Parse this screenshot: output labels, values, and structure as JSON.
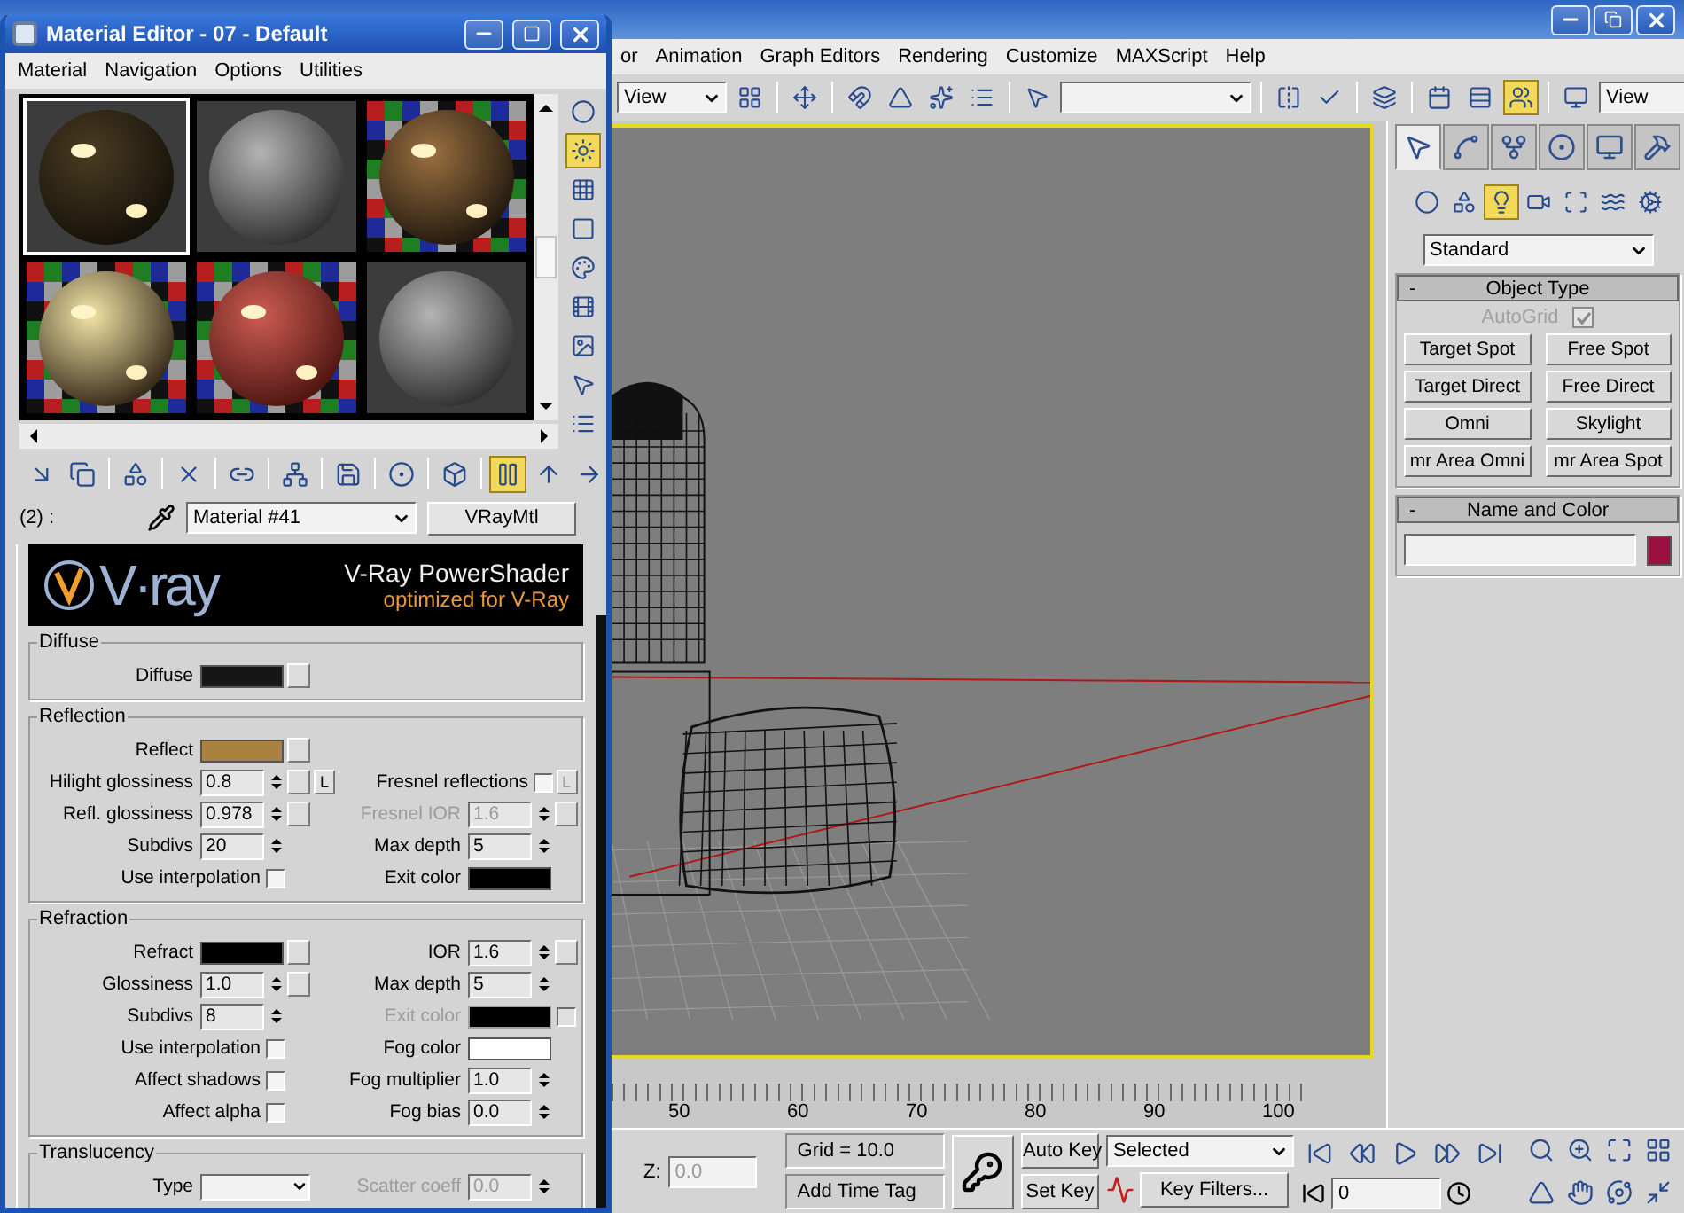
{
  "material_editor": {
    "title": "Material Editor - 07 - Default",
    "menu": [
      {
        "label": "Material"
      },
      {
        "label": "Navigation"
      },
      {
        "label": "Options"
      },
      {
        "label": "Utilities"
      }
    ],
    "samples": [
      {
        "kind": "dark",
        "checker": false,
        "selected": true
      },
      {
        "kind": "grey",
        "checker": false,
        "selected": false
      },
      {
        "kind": "bronze",
        "checker": true,
        "selected": false
      },
      {
        "kind": "mirror",
        "checker": true,
        "selected": false
      },
      {
        "kind": "red",
        "checker": true,
        "selected": false
      },
      {
        "kind": "grey",
        "checker": false,
        "selected": false
      }
    ],
    "side_tools": [
      {
        "kind": "circle",
        "on": false
      },
      {
        "kind": "sun",
        "on": true
      },
      {
        "kind": "grid",
        "on": false
      },
      {
        "kind": "square",
        "on": false
      },
      {
        "kind": "palette",
        "on": false
      },
      {
        "kind": "film",
        "on": false
      },
      {
        "kind": "image",
        "on": false
      },
      {
        "kind": "pointer",
        "on": false
      },
      {
        "kind": "list",
        "on": false
      }
    ],
    "toolbar": [
      {
        "kind": "arrow-down-right",
        "on": false
      },
      {
        "kind": "copy",
        "on": false
      },
      {
        "kind": "separator"
      },
      {
        "kind": "shapes",
        "on": false
      },
      {
        "kind": "separator"
      },
      {
        "kind": "cross",
        "on": false
      },
      {
        "kind": "separator"
      },
      {
        "kind": "link",
        "on": false
      },
      {
        "kind": "separator"
      },
      {
        "kind": "network",
        "on": false
      },
      {
        "kind": "separator"
      },
      {
        "kind": "save",
        "on": false
      },
      {
        "kind": "separator"
      },
      {
        "kind": "circle-dot",
        "on": false
      },
      {
        "kind": "separator"
      },
      {
        "kind": "box",
        "on": false
      },
      {
        "kind": "separator"
      },
      {
        "kind": "vertical-bars",
        "on": true
      },
      {
        "kind": "arrow-up",
        "on": false
      },
      {
        "kind": "arrow-right",
        "on": false
      }
    ],
    "slot_label": "(2) :",
    "material_name": "Material #41",
    "material_type": "VRayMtl",
    "banner": {
      "logo": "V·ray",
      "title": "V-Ray PowerShader",
      "subtitle": "optimized for V-Ray"
    },
    "groups": [
      {
        "title": "Diffuse",
        "rows": [
          {
            "left": {
              "kind": "color",
              "label": "Diffuse",
              "color": "#161616",
              "map": true
            }
          }
        ]
      },
      {
        "title": "Reflection",
        "rows": [
          {
            "left": {
              "kind": "color",
              "label": "Reflect",
              "color": "#a8823e",
              "map": true
            }
          },
          {
            "left": {
              "kind": "spinner",
              "label": "Hilight glossiness",
              "value": "0.8",
              "map": true,
              "lock": {
                "label": "L",
                "disabled": false
              }
            },
            "right": {
              "kind": "check",
              "label": "Fresnel reflections",
              "checked": false,
              "lock": {
                "label": "L",
                "disabled": true
              }
            }
          },
          {
            "left": {
              "kind": "spinner",
              "label": "Refl. glossiness",
              "value": "0.978",
              "map": true
            },
            "right": {
              "kind": "spinner",
              "label": "Fresnel IOR",
              "value": "1.6",
              "map": true,
              "disabled": true
            }
          },
          {
            "left": {
              "kind": "spinner",
              "label": "Subdivs",
              "value": "20"
            },
            "right": {
              "kind": "spinner",
              "label": "Max depth",
              "value": "5"
            }
          },
          {
            "left": {
              "kind": "check",
              "label": "Use interpolation",
              "checked": false
            },
            "right": {
              "kind": "color",
              "label": "Exit color",
              "color": "#000000"
            }
          }
        ]
      },
      {
        "title": "Refraction",
        "rows": [
          {
            "left": {
              "kind": "color",
              "label": "Refract",
              "color": "#000000",
              "map": true
            },
            "right": {
              "kind": "spinner",
              "label": "IOR",
              "value": "1.6",
              "map": true
            }
          },
          {
            "left": {
              "kind": "spinner",
              "label": "Glossiness",
              "value": "1.0",
              "map": true
            },
            "right": {
              "kind": "spinner",
              "label": "Max depth",
              "value": "5"
            }
          },
          {
            "left": {
              "kind": "spinner",
              "label": "Subdivs",
              "value": "8"
            },
            "right": {
              "kind": "color",
              "label": "Exit color",
              "color": "#000000",
              "disabled": true,
              "checked": false
            }
          },
          {
            "left": {
              "kind": "check",
              "label": "Use interpolation",
              "checked": false
            },
            "right": {
              "kind": "color",
              "label": "Fog color",
              "color": "#ffffff"
            }
          },
          {
            "left": {
              "kind": "check",
              "label": "Affect shadows",
              "checked": false
            },
            "right": {
              "kind": "spinner",
              "label": "Fog multiplier",
              "value": "1.0"
            }
          },
          {
            "left": {
              "kind": "check",
              "label": "Affect alpha",
              "checked": false
            },
            "right": {
              "kind": "spinner",
              "label": "Fog bias",
              "value": "0.0"
            }
          }
        ]
      },
      {
        "title": "Translucency",
        "rows": [
          {
            "left": {
              "kind": "dropdown",
              "label": "Type"
            },
            "right": {
              "kind": "spinner",
              "label": "Scatter coeff",
              "value": "0.0",
              "disabled": true
            }
          }
        ]
      }
    ]
  },
  "main": {
    "menu": [
      {
        "label": "or"
      },
      {
        "label": "Animation"
      },
      {
        "label": "Graph Editors"
      },
      {
        "label": "Rendering"
      },
      {
        "label": "Customize"
      },
      {
        "label": "MAXScript"
      },
      {
        "label": "Help"
      }
    ],
    "toolbar": [
      {
        "kind": "dropdown",
        "value": "View"
      },
      {
        "kind": "layout-grid",
        "on": false
      },
      {
        "kind": "separator"
      },
      {
        "kind": "move",
        "on": false
      },
      {
        "kind": "separator"
      },
      {
        "kind": "magnet",
        "on": false
      },
      {
        "kind": "triangle",
        "on": false
      },
      {
        "kind": "sparkles",
        "on": false
      },
      {
        "kind": "list",
        "on": false
      },
      {
        "kind": "separator"
      },
      {
        "kind": "pointer",
        "on": false
      },
      {
        "kind": "dropdown"
      },
      {
        "kind": "separator"
      },
      {
        "kind": "mirror",
        "on": false
      },
      {
        "kind": "check",
        "on": false
      },
      {
        "kind": "separator"
      },
      {
        "kind": "layers",
        "on": false
      },
      {
        "kind": "separator"
      },
      {
        "kind": "calendar",
        "on": false
      },
      {
        "kind": "rows",
        "on": false
      },
      {
        "kind": "users",
        "on": true
      },
      {
        "kind": "separator"
      },
      {
        "kind": "monitor",
        "on": false
      },
      {
        "kind": "dropdown",
        "value": "View"
      }
    ],
    "viewport": {
      "active": true
    },
    "ruler": {
      "labels": [
        "50",
        "60",
        "70",
        "80",
        "90",
        "100"
      ]
    },
    "command_panel": {
      "tabs": [
        {
          "kind": "pointer",
          "selected": true
        },
        {
          "kind": "curve",
          "selected": false
        },
        {
          "kind": "git-fork",
          "selected": false
        },
        {
          "kind": "circle-dot",
          "selected": false
        },
        {
          "kind": "monitor",
          "selected": false
        },
        {
          "kind": "hammer",
          "selected": false
        }
      ],
      "categories": [
        {
          "kind": "circle",
          "selected": false
        },
        {
          "kind": "shapes",
          "selected": false
        },
        {
          "kind": "lightbulb",
          "selected": true
        },
        {
          "kind": "camera",
          "selected": false
        },
        {
          "kind": "scan",
          "selected": false
        },
        {
          "kind": "waves",
          "selected": false
        },
        {
          "kind": "cog",
          "selected": false
        }
      ],
      "type_dropdown": "Standard",
      "rollouts": [
        {
          "kind": "buttons",
          "toggle": "-",
          "title": "Object Type",
          "autogrid": {
            "label": "AutoGrid",
            "checked": true,
            "disabled": true
          },
          "buttons": [
            "Target Spot",
            "Free Spot",
            "Target Direct",
            "Free Direct",
            "Omni",
            "Skylight",
            "mr Area Omni",
            "mr Area Spot"
          ]
        },
        {
          "kind": "name",
          "toggle": "-",
          "title": "Name and Color",
          "color": "#9a1040"
        }
      ]
    },
    "status": {
      "z_label": "Z:",
      "z_value": "0.0",
      "grid": "Grid = 10.0",
      "time_tag": "Add Time Tag",
      "auto_key": "Auto Key",
      "set_key": "Set Key",
      "key_mode": "Selected",
      "key_filters": "Key Filters...",
      "frame": "0",
      "playback": [
        {
          "kind": "skip-back"
        },
        {
          "kind": "rewind"
        },
        {
          "kind": "play"
        },
        {
          "kind": "fast-forward"
        },
        {
          "kind": "skip-forward"
        }
      ],
      "nav": [
        {
          "kind": "search"
        },
        {
          "kind": "zoom-in"
        },
        {
          "kind": "maximize"
        },
        {
          "kind": "layout-grid"
        },
        {
          "kind": "triangle"
        },
        {
          "kind": "hand"
        },
        {
          "kind": "orbit"
        },
        {
          "kind": "minimize"
        }
      ]
    }
  }
}
